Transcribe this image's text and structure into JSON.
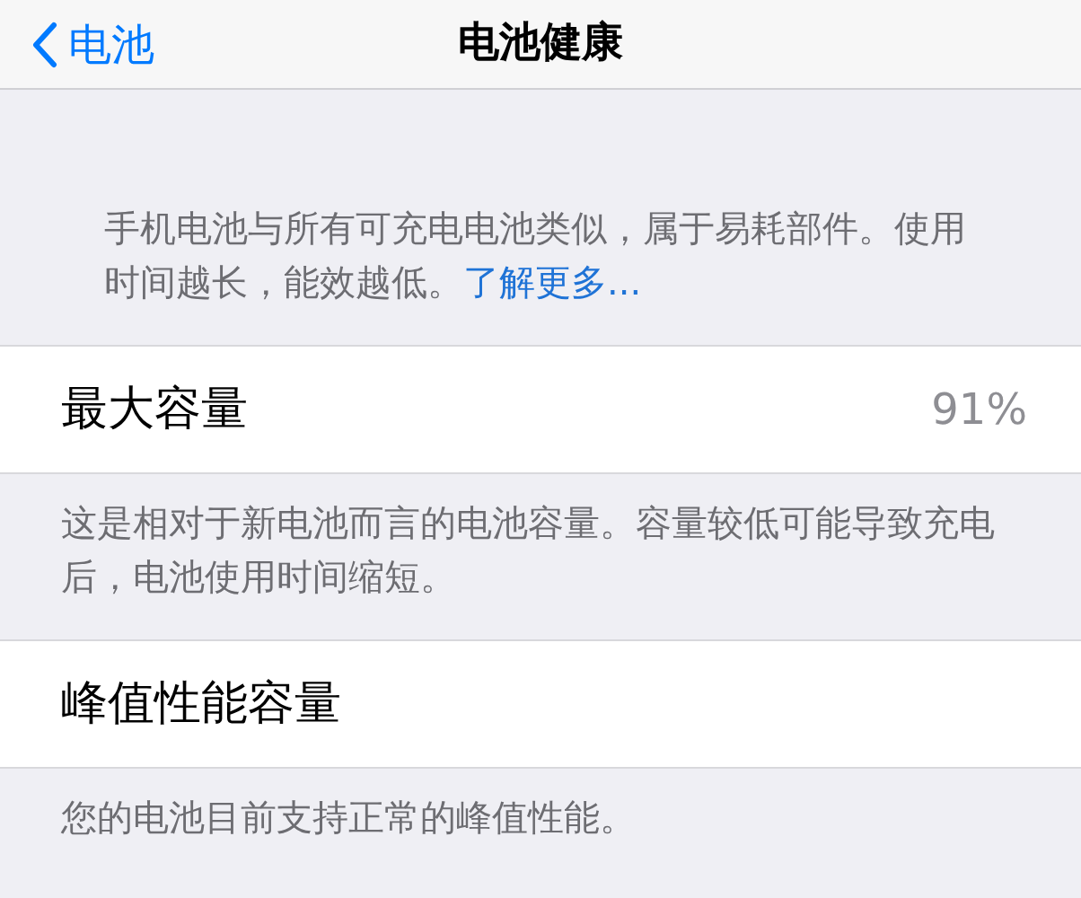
{
  "nav_bar": {
    "back_label": "电池",
    "title": "电池健康"
  },
  "intro": {
    "text": "手机电池与所有可充电电池类似，属于易耗部件。使用时间越长，能效越低。",
    "link": "了解更多..."
  },
  "sections": [
    {
      "label": "最大容量",
      "value": "91%",
      "footer": "这是相对于新电池而言的电池容量。容量较低可能导致充电后，电池使用时间缩短。"
    },
    {
      "label": "峰值性能容量",
      "footer": "您的电池目前支持正常的峰值性能。"
    }
  ]
}
